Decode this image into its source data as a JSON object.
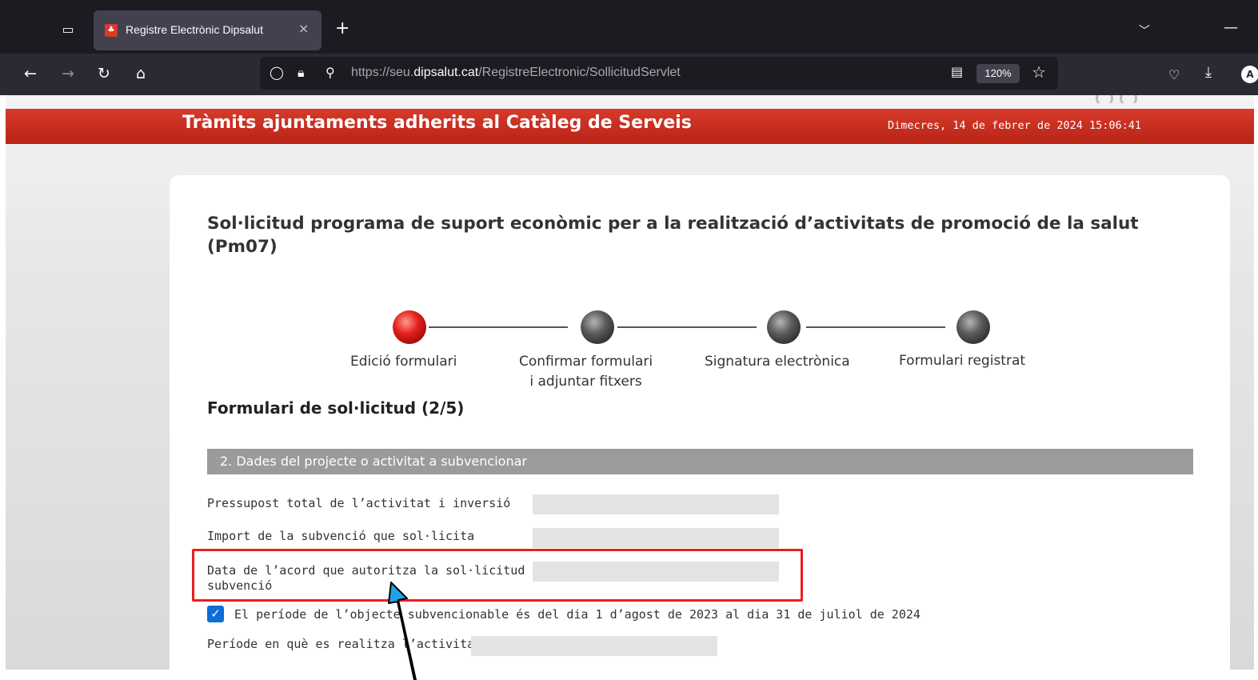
{
  "browser": {
    "tab_title": "Registre Electrònic Dipsalut",
    "tab_close": "×",
    "new_tab": "+",
    "url_prefix": "https://seu.",
    "url_domain": "dipsalut.cat",
    "url_path": "/RegistreElectronic/SollicitudServlet",
    "zoom": "120%",
    "account_initial": "A"
  },
  "banner": {
    "title": "Tràmits ajuntaments adherits al Catàleg de Serveis",
    "date": "Dimecres, 14 de febrer de 2024 15:06:41"
  },
  "form": {
    "title": "Sol·licitud programa de suport econòmic per a la realització d’activitats de promoció de la salut (Pm07)",
    "steps": [
      {
        "label": "Edició formulari",
        "state": "active",
        "color": "#e3201a"
      },
      {
        "label": "Confirmar formulari",
        "label2": "i adjuntar fitxers",
        "state": "pending",
        "color": "#555555"
      },
      {
        "label": "Signatura electrònica",
        "state": "pending",
        "color": "#555555"
      },
      {
        "label": "Formulari registrat",
        "state": "pending",
        "color": "#555555"
      }
    ],
    "section_heading": "Formulari de sol·licitud (2/5)",
    "section_bar": "2. Dades del projecte o activitat a subvencionar",
    "fields": [
      {
        "label": "Pressupost total de l’activitat i inversió",
        "value": ""
      },
      {
        "label": "Import de la subvenció que sol·licita",
        "value": ""
      },
      {
        "label": "Data de l’acord que autoritza la sol·licitud de",
        "label2": "subvenció",
        "value": ""
      }
    ],
    "checkbox": {
      "checked": true,
      "label": "El període de l’objecte subvencionable és del dia 1 d’agost de 2023 al dia 31 de juliol de 2024"
    },
    "period_field": {
      "label": "Període en què es realitza l’activitat",
      "value": ""
    }
  },
  "annotation": {
    "highlight_color": "#ee1c1c",
    "arrow_color": "#1ca3e8"
  }
}
